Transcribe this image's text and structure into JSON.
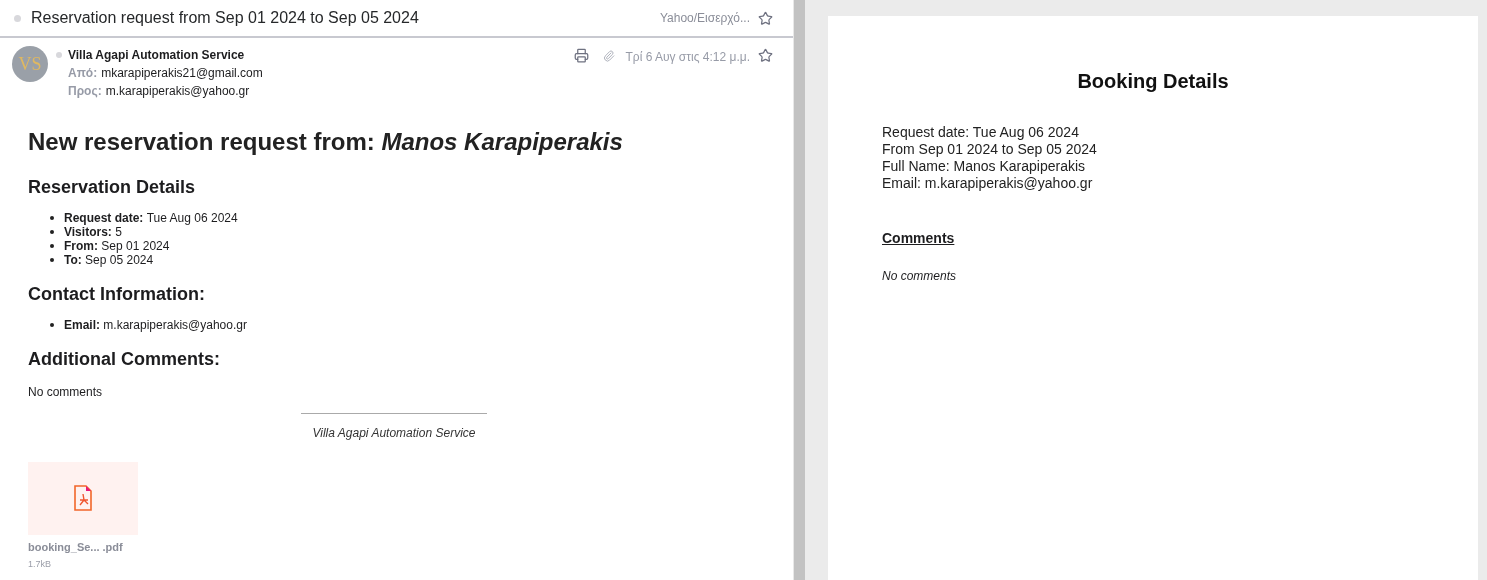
{
  "email": {
    "subject": "Reservation request from Sep 01 2024 to Sep 05 2024",
    "folder": "Yahoo/Εισερχό...",
    "avatar": "VS",
    "sender": "Villa Agapi Automation Service",
    "from_label": "Από:",
    "from": "mkarapiperakis21@gmail.com",
    "to_label": "Προς:",
    "to": "m.karapiperakis@yahoo.gr",
    "date": "Τρί 6 Αυγ στις 4:12 μ.μ.",
    "body": {
      "title": "New reservation request from: *Manos Karapiperakis*",
      "sections": [
        {
          "heading": "Reservation Details",
          "items": [
            {
              "label": "Request date:",
              "value": "Tue Aug 06 2024"
            },
            {
              "label": "Visitors:",
              "value": "5"
            },
            {
              "label": "From:",
              "value": "Sep 01 2024"
            },
            {
              "label": "To:",
              "value": "Sep 05 2024"
            }
          ]
        },
        {
          "heading": "Contact Information:",
          "items": [
            {
              "label": "Email:",
              "value": "m.karapiperakis@yahoo.gr"
            }
          ]
        },
        {
          "heading": "Additional Comments:",
          "text": "No comments"
        }
      ],
      "signature": "Villa Agapi Automation Service"
    },
    "attachment": {
      "name": "booking_Se... .pdf",
      "size": "1.7kB"
    }
  },
  "preview": {
    "title": "Booking Details",
    "lines": [
      "Request date: Tue Aug 06 2024",
      "From Sep 01 2024 to Sep 05 2024",
      "Full Name: Manos Karapiperakis",
      "Email: m.karapiperakis@yahoo.gr"
    ],
    "comments_heading": "Comments",
    "comments": "No comments"
  }
}
